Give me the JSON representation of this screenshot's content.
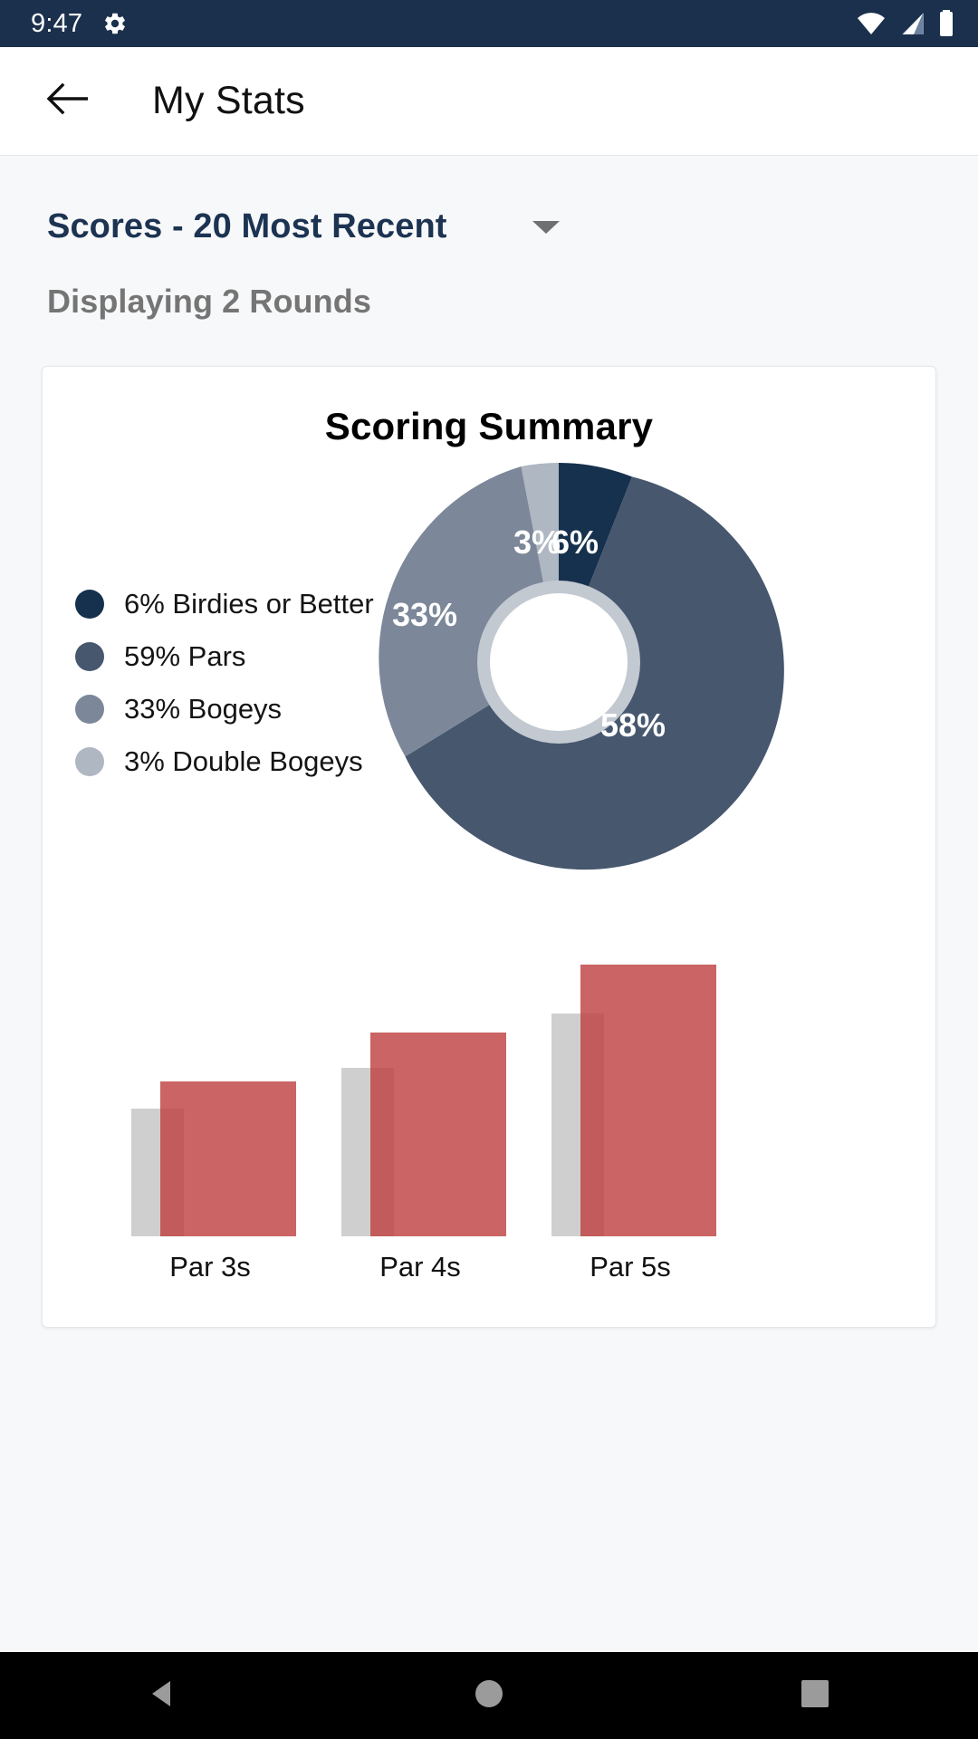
{
  "status_bar": {
    "time": "9:47",
    "icons": [
      "gear-icon",
      "wifi-icon",
      "cellular-signal-icon",
      "battery-icon"
    ],
    "background": "#1a304d"
  },
  "app_bar": {
    "back_icon": "arrow-back-icon",
    "title": "My Stats"
  },
  "selector": {
    "label": "Scores - 20 Most Recent",
    "caret_icon": "chevron-down-icon",
    "color": "#1c3352"
  },
  "rounds_text": "Displaying 2 Rounds",
  "card": {
    "title": "Scoring Summary"
  },
  "chart_data": [
    {
      "type": "pie",
      "title": "Scoring Summary",
      "variant": "donut",
      "legend_position": "left",
      "categories": [
        "Birdies or Better",
        "Pars",
        "Bogeys",
        "Double Bogeys"
      ],
      "values": [
        6,
        59,
        33,
        3
      ],
      "slice_labels": [
        "6%",
        "58%",
        "33%",
        "3%"
      ],
      "legend_entries": [
        "6% Birdies or Better",
        "59% Pars",
        "33% Bogeys",
        "3% Double Bogeys"
      ],
      "colors": [
        "#16314d",
        "#46576e",
        "#7c8799",
        "#aeb7c2"
      ],
      "ylabel": "",
      "xlabel": ""
    },
    {
      "type": "bar",
      "categories": [
        "Par 3s",
        "Par 4s",
        "Par 5s"
      ],
      "series": [
        {
          "name": "background",
          "values": [
            47,
            62,
            82
          ],
          "color": "#cfcfcf"
        },
        {
          "name": "foreground",
          "values": [
            57,
            75,
            100
          ],
          "color": "#be3d3d"
        }
      ],
      "ylim": [
        0,
        100
      ],
      "grid": false,
      "ylabel": "",
      "xlabel": ""
    }
  ],
  "nav_bar": {
    "back_icon": "nav-back-triangle-icon",
    "home_icon": "nav-home-circle-icon",
    "recents_icon": "nav-recents-square-icon"
  }
}
